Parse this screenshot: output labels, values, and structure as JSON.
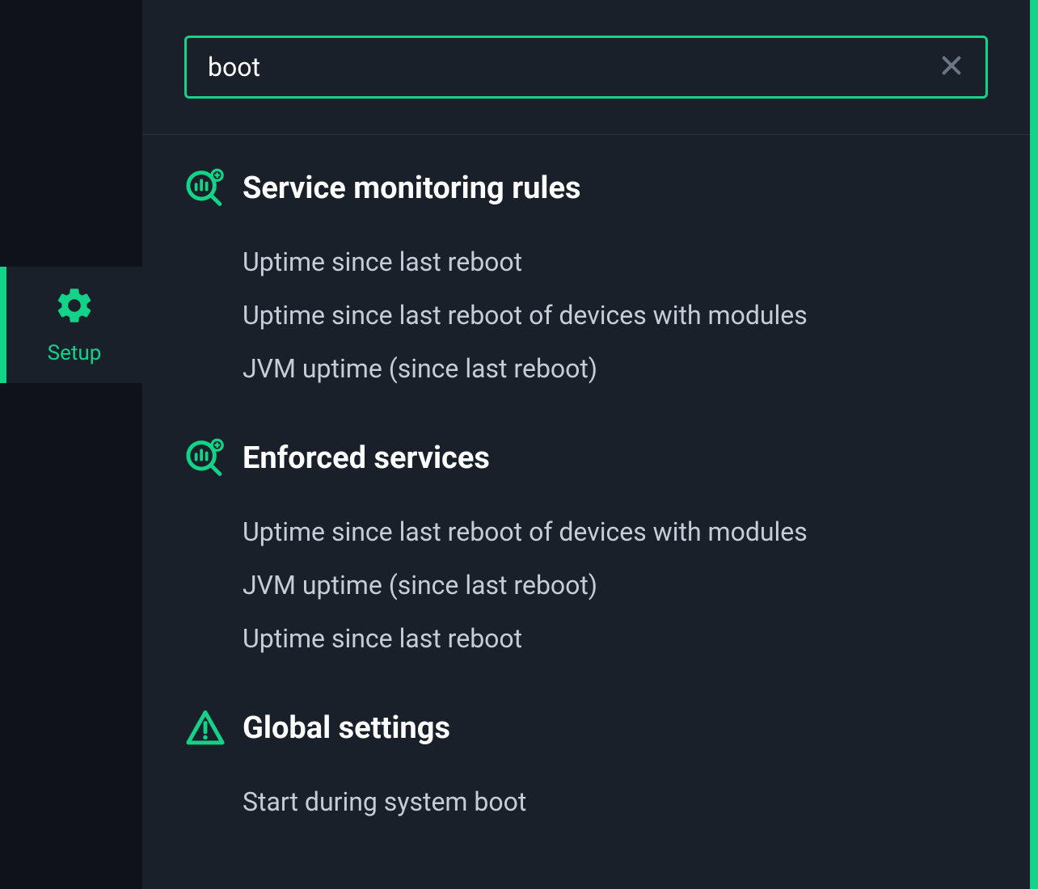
{
  "sidebar": {
    "setup_label": "Setup"
  },
  "search": {
    "value": "boot",
    "placeholder": ""
  },
  "groups": [
    {
      "icon": "monitoring",
      "title": "Service monitoring rules",
      "items": [
        "Uptime since last reboot",
        "Uptime since last reboot of devices with modules",
        "JVM uptime (since last reboot)"
      ]
    },
    {
      "icon": "monitoring",
      "title": "Enforced services",
      "items": [
        "Uptime since last reboot of devices with modules",
        "JVM uptime (since last reboot)",
        "Uptime since last reboot"
      ]
    },
    {
      "icon": "warning",
      "title": "Global settings",
      "items": [
        "Start during system boot"
      ]
    }
  ]
}
